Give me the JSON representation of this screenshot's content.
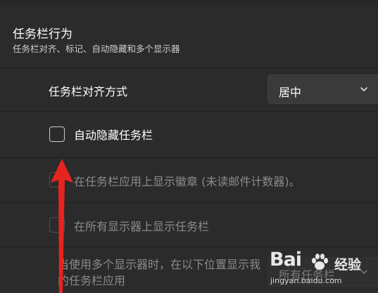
{
  "section": {
    "title": "任务栏行为",
    "subtitle": "任务栏对齐、标记、自动隐藏和多个显示器"
  },
  "rows": [
    {
      "label": "任务栏对齐方式",
      "dropdown_value": "居中",
      "enabled": true
    },
    {
      "label": "自动隐藏任务栏",
      "checked": false,
      "enabled": true
    },
    {
      "label": "在任务栏应用上显示徽章 (未读邮件计数器)。",
      "checked": false,
      "enabled": false
    },
    {
      "label": "在所有显示器上显示任务栏",
      "checked": false,
      "enabled": false
    },
    {
      "label": "当使用多个显示器时，在以下位置显示我的任务栏应用",
      "dropdown_value": "所有任务栏",
      "enabled": false
    }
  ],
  "annotation": {
    "color": "#e8231f"
  },
  "watermark": {
    "brand": "Bai",
    "brand2": "经验",
    "url": "jingyan.baidu.com"
  },
  "colors": {
    "background": "#202020",
    "card": "#2b2b2b",
    "text": "#ffffff",
    "disabled_text": "#8b8b8b",
    "dropdown": "#3a3a3a"
  }
}
